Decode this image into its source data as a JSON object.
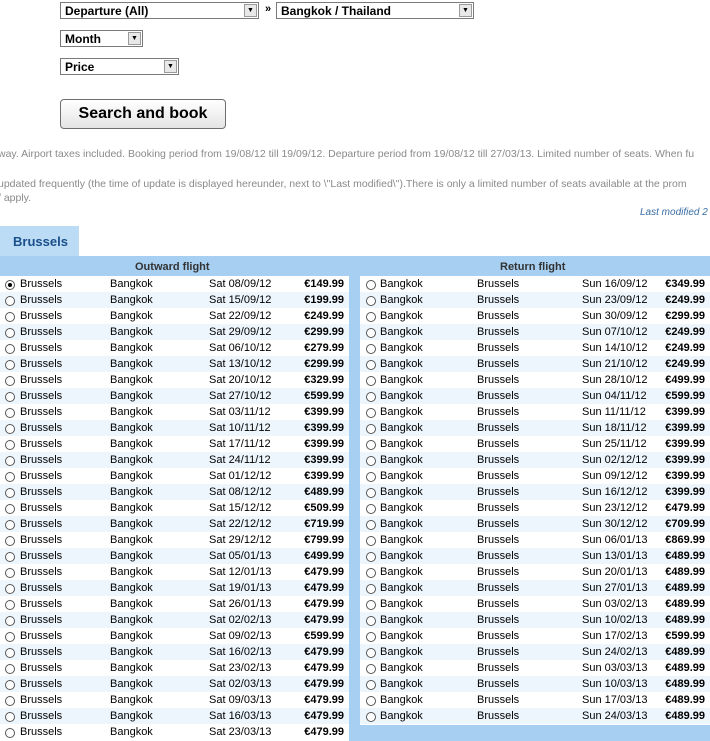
{
  "filters": {
    "departure": "Departure (All)",
    "arrow": "»",
    "destination": "Bangkok / Thailand",
    "month": "Month",
    "price": "Price",
    "search_button": "Search and book"
  },
  "notes": {
    "line1": "way. Airport taxes included. Booking period from 19/08/12 till 19/09/12. Departure period from 19/08/12 till 27/03/13. Limited number of seats. When fu",
    "line2": "updated frequently (the time of update is displayed hereunder, next to \\\"Last modified\\\").There is only a limited number of seats available at the prom",
    "line3": "/ apply.",
    "last_modified": "Last modified 2"
  },
  "tab": "Brussels",
  "outward": {
    "title": "Outward flight",
    "rows": [
      {
        "from": "Brussels",
        "to": "Bangkok",
        "date": "Sat 08/09/12",
        "price": "€149.99",
        "selected": true
      },
      {
        "from": "Brussels",
        "to": "Bangkok",
        "date": "Sat 15/09/12",
        "price": "€199.99"
      },
      {
        "from": "Brussels",
        "to": "Bangkok",
        "date": "Sat 22/09/12",
        "price": "€249.99"
      },
      {
        "from": "Brussels",
        "to": "Bangkok",
        "date": "Sat 29/09/12",
        "price": "€299.99"
      },
      {
        "from": "Brussels",
        "to": "Bangkok",
        "date": "Sat 06/10/12",
        "price": "€279.99"
      },
      {
        "from": "Brussels",
        "to": "Bangkok",
        "date": "Sat 13/10/12",
        "price": "€299.99"
      },
      {
        "from": "Brussels",
        "to": "Bangkok",
        "date": "Sat 20/10/12",
        "price": "€329.99"
      },
      {
        "from": "Brussels",
        "to": "Bangkok",
        "date": "Sat 27/10/12",
        "price": "€599.99"
      },
      {
        "from": "Brussels",
        "to": "Bangkok",
        "date": "Sat 03/11/12",
        "price": "€399.99"
      },
      {
        "from": "Brussels",
        "to": "Bangkok",
        "date": "Sat 10/11/12",
        "price": "€399.99"
      },
      {
        "from": "Brussels",
        "to": "Bangkok",
        "date": "Sat 17/11/12",
        "price": "€399.99"
      },
      {
        "from": "Brussels",
        "to": "Bangkok",
        "date": "Sat 24/11/12",
        "price": "€399.99"
      },
      {
        "from": "Brussels",
        "to": "Bangkok",
        "date": "Sat 01/12/12",
        "price": "€399.99"
      },
      {
        "from": "Brussels",
        "to": "Bangkok",
        "date": "Sat 08/12/12",
        "price": "€489.99"
      },
      {
        "from": "Brussels",
        "to": "Bangkok",
        "date": "Sat 15/12/12",
        "price": "€509.99"
      },
      {
        "from": "Brussels",
        "to": "Bangkok",
        "date": "Sat 22/12/12",
        "price": "€719.99"
      },
      {
        "from": "Brussels",
        "to": "Bangkok",
        "date": "Sat 29/12/12",
        "price": "€799.99"
      },
      {
        "from": "Brussels",
        "to": "Bangkok",
        "date": "Sat 05/01/13",
        "price": "€499.99"
      },
      {
        "from": "Brussels",
        "to": "Bangkok",
        "date": "Sat 12/01/13",
        "price": "€479.99"
      },
      {
        "from": "Brussels",
        "to": "Bangkok",
        "date": "Sat 19/01/13",
        "price": "€479.99"
      },
      {
        "from": "Brussels",
        "to": "Bangkok",
        "date": "Sat 26/01/13",
        "price": "€479.99"
      },
      {
        "from": "Brussels",
        "to": "Bangkok",
        "date": "Sat 02/02/13",
        "price": "€479.99"
      },
      {
        "from": "Brussels",
        "to": "Bangkok",
        "date": "Sat 09/02/13",
        "price": "€599.99"
      },
      {
        "from": "Brussels",
        "to": "Bangkok",
        "date": "Sat 16/02/13",
        "price": "€479.99"
      },
      {
        "from": "Brussels",
        "to": "Bangkok",
        "date": "Sat 23/02/13",
        "price": "€479.99"
      },
      {
        "from": "Brussels",
        "to": "Bangkok",
        "date": "Sat 02/03/13",
        "price": "€479.99"
      },
      {
        "from": "Brussels",
        "to": "Bangkok",
        "date": "Sat 09/03/13",
        "price": "€479.99"
      },
      {
        "from": "Brussels",
        "to": "Bangkok",
        "date": "Sat 16/03/13",
        "price": "€479.99"
      },
      {
        "from": "Brussels",
        "to": "Bangkok",
        "date": "Sat 23/03/13",
        "price": "€479.99"
      }
    ]
  },
  "return": {
    "title": "Return flight",
    "rows": [
      {
        "from": "Bangkok",
        "to": "Brussels",
        "date": "Sun 16/09/12",
        "price": "€349.99"
      },
      {
        "from": "Bangkok",
        "to": "Brussels",
        "date": "Sun 23/09/12",
        "price": "€249.99"
      },
      {
        "from": "Bangkok",
        "to": "Brussels",
        "date": "Sun 30/09/12",
        "price": "€299.99"
      },
      {
        "from": "Bangkok",
        "to": "Brussels",
        "date": "Sun 07/10/12",
        "price": "€249.99"
      },
      {
        "from": "Bangkok",
        "to": "Brussels",
        "date": "Sun 14/10/12",
        "price": "€249.99"
      },
      {
        "from": "Bangkok",
        "to": "Brussels",
        "date": "Sun 21/10/12",
        "price": "€249.99"
      },
      {
        "from": "Bangkok",
        "to": "Brussels",
        "date": "Sun 28/10/12",
        "price": "€499.99"
      },
      {
        "from": "Bangkok",
        "to": "Brussels",
        "date": "Sun 04/11/12",
        "price": "€599.99"
      },
      {
        "from": "Bangkok",
        "to": "Brussels",
        "date": "Sun 11/11/12",
        "price": "€399.99"
      },
      {
        "from": "Bangkok",
        "to": "Brussels",
        "date": "Sun 18/11/12",
        "price": "€399.99"
      },
      {
        "from": "Bangkok",
        "to": "Brussels",
        "date": "Sun 25/11/12",
        "price": "€399.99"
      },
      {
        "from": "Bangkok",
        "to": "Brussels",
        "date": "Sun 02/12/12",
        "price": "€399.99"
      },
      {
        "from": "Bangkok",
        "to": "Brussels",
        "date": "Sun 09/12/12",
        "price": "€399.99"
      },
      {
        "from": "Bangkok",
        "to": "Brussels",
        "date": "Sun 16/12/12",
        "price": "€399.99"
      },
      {
        "from": "Bangkok",
        "to": "Brussels",
        "date": "Sun 23/12/12",
        "price": "€479.99"
      },
      {
        "from": "Bangkok",
        "to": "Brussels",
        "date": "Sun 30/12/12",
        "price": "€709.99"
      },
      {
        "from": "Bangkok",
        "to": "Brussels",
        "date": "Sun 06/01/13",
        "price": "€869.99"
      },
      {
        "from": "Bangkok",
        "to": "Brussels",
        "date": "Sun 13/01/13",
        "price": "€489.99"
      },
      {
        "from": "Bangkok",
        "to": "Brussels",
        "date": "Sun 20/01/13",
        "price": "€489.99"
      },
      {
        "from": "Bangkok",
        "to": "Brussels",
        "date": "Sun 27/01/13",
        "price": "€489.99"
      },
      {
        "from": "Bangkok",
        "to": "Brussels",
        "date": "Sun 03/02/13",
        "price": "€489.99"
      },
      {
        "from": "Bangkok",
        "to": "Brussels",
        "date": "Sun 10/02/13",
        "price": "€489.99"
      },
      {
        "from": "Bangkok",
        "to": "Brussels",
        "date": "Sun 17/02/13",
        "price": "€599.99"
      },
      {
        "from": "Bangkok",
        "to": "Brussels",
        "date": "Sun 24/02/13",
        "price": "€489.99"
      },
      {
        "from": "Bangkok",
        "to": "Brussels",
        "date": "Sun 03/03/13",
        "price": "€489.99"
      },
      {
        "from": "Bangkok",
        "to": "Brussels",
        "date": "Sun 10/03/13",
        "price": "€489.99"
      },
      {
        "from": "Bangkok",
        "to": "Brussels",
        "date": "Sun 17/03/13",
        "price": "€489.99"
      },
      {
        "from": "Bangkok",
        "to": "Brussels",
        "date": "Sun 24/03/13",
        "price": "€489.99"
      }
    ]
  }
}
